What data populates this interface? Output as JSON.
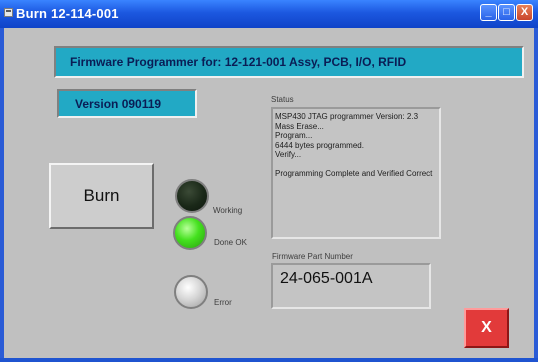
{
  "window": {
    "title": "Burn 12-114-001",
    "controls": {
      "minimize": "_",
      "maximize": "□",
      "close": "X"
    }
  },
  "header": {
    "text": "Firmware Programmer for:  12-121-001 Assy, PCB, I/O, RFID"
  },
  "version": {
    "text": "Version 090119"
  },
  "status": {
    "label": "Status",
    "lines": [
      "MSP430 JTAG programmer Version: 2.3",
      "Mass Erase...",
      "Program...",
      "6444 bytes programmed.",
      "Verify...",
      "",
      "Programming Complete and Verified Correct"
    ]
  },
  "burn_button": {
    "label": "Burn"
  },
  "indicators": {
    "working": {
      "label": "Working",
      "state": "off"
    },
    "done": {
      "label": "Done OK",
      "state": "on"
    },
    "error": {
      "label": "Error",
      "state": "off"
    }
  },
  "firmware_part": {
    "label": "Firmware Part Number",
    "value": "24-065-001A"
  },
  "exit_button": {
    "label": "X"
  },
  "colors": {
    "title_bar": "#1c58e0",
    "panel": "#c0c0c0",
    "accent_box": "#22a9c5",
    "accent_text": "#0a1d55",
    "exit_button": "#e23a3a",
    "led_done": "#44e11e"
  },
  "icons": {
    "app": "app-icon",
    "minimize": "minimize-icon",
    "maximize": "maximize-icon",
    "close": "close-icon"
  }
}
